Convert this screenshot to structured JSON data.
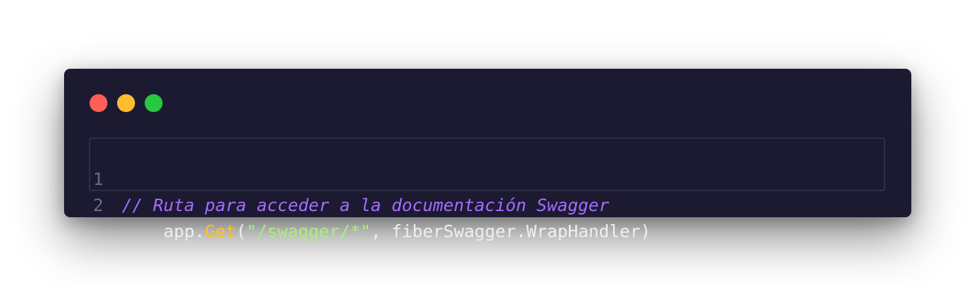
{
  "window": {
    "controls": {
      "close_color": "#ff5f57",
      "minimize_color": "#febc2e",
      "maximize_color": "#28c840"
    }
  },
  "editor": {
    "lines": [
      {
        "number": "1",
        "comment": "// Ruta para acceder a la documentación Swagger"
      },
      {
        "number": "2",
        "indent": "    ",
        "object": "app",
        "dot": ".",
        "method": "Get",
        "open_paren": "(",
        "string": "\"/swagger/*\"",
        "separator": ", ",
        "argument": "fiberSwagger.WrapHandler",
        "close_paren": ")"
      }
    ]
  }
}
